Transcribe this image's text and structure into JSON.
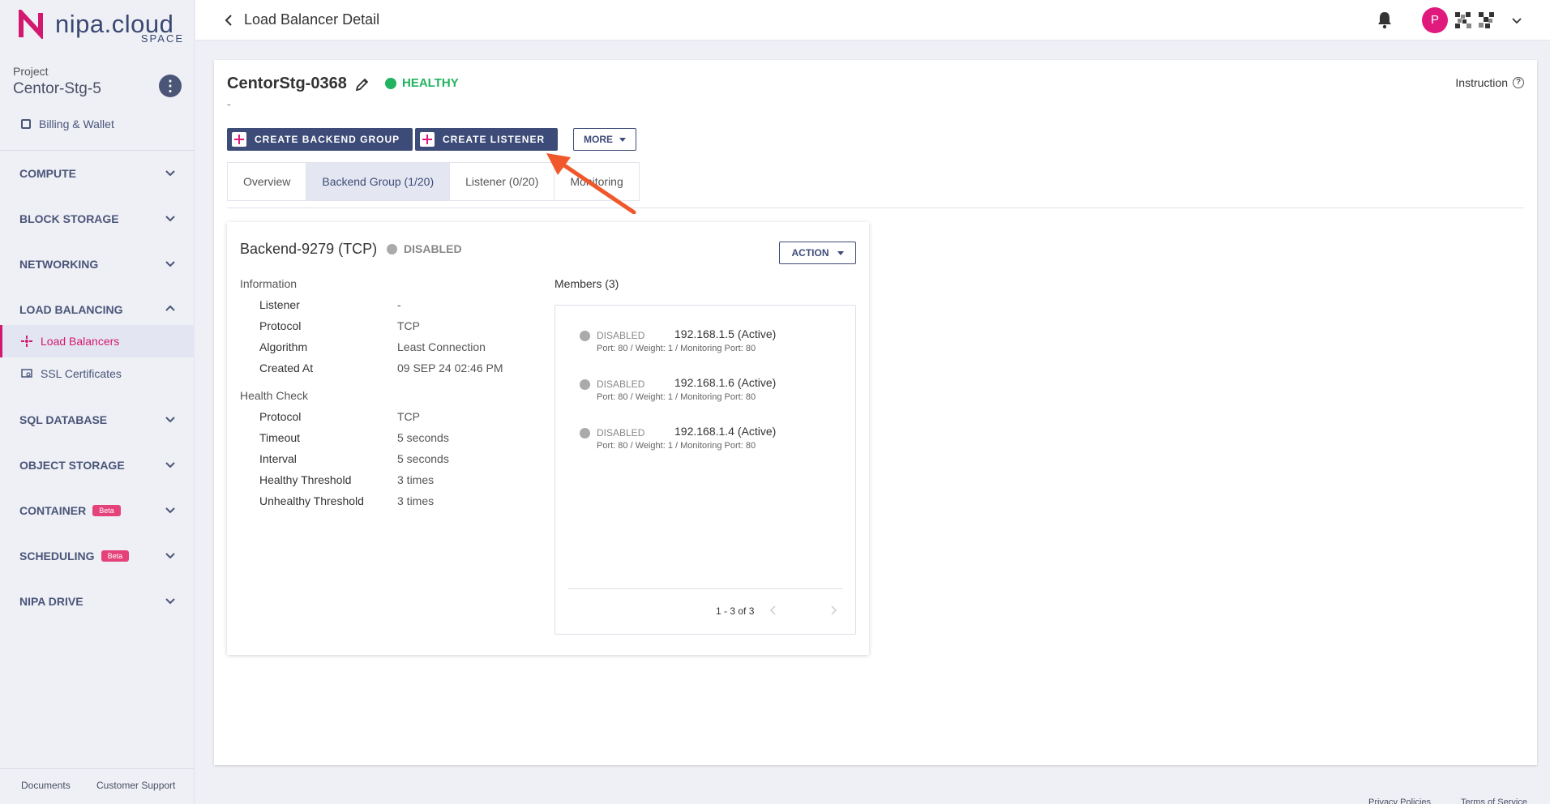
{
  "brand": {
    "name": "nipa.cloud",
    "sub": "SPACE"
  },
  "sidebar": {
    "project_label": "Project",
    "project_name": "Centor-Stg-5",
    "billing": "Billing & Wallet",
    "items": [
      {
        "label": "COMPUTE"
      },
      {
        "label": "BLOCK STORAGE"
      },
      {
        "label": "NETWORKING"
      },
      {
        "label": "LOAD BALANCING"
      },
      {
        "label": "SQL DATABASE"
      },
      {
        "label": "OBJECT STORAGE"
      },
      {
        "label": "CONTAINER",
        "badge": "Beta"
      },
      {
        "label": "SCHEDULING",
        "badge": "Beta"
      },
      {
        "label": "NIPA DRIVE"
      }
    ],
    "sub_items": [
      {
        "label": "Load Balancers"
      },
      {
        "label": "SSL Certificates"
      }
    ],
    "footer": {
      "documents": "Documents",
      "support": "Customer Support"
    }
  },
  "topbar": {
    "title": "Load Balancer Detail",
    "avatar_initial": "P"
  },
  "lb": {
    "name": "CentorStg-0368",
    "status": "HEALTHY",
    "description": "-",
    "instruction": "Instruction",
    "buttons": {
      "create_backend": "CREATE BACKEND GROUP",
      "create_listener": "CREATE LISTENER",
      "more": "MORE"
    },
    "tabs": [
      "Overview",
      "Backend Group (1/20)",
      "Listener (0/20)",
      "Monitoring"
    ]
  },
  "backend": {
    "title": "Backend-9279 (TCP)",
    "status": "DISABLED",
    "action": "ACTION",
    "info_label": "Information",
    "info": [
      {
        "key": "Listener",
        "value": "-"
      },
      {
        "key": "Protocol",
        "value": "TCP"
      },
      {
        "key": "Algorithm",
        "value": "Least Connection"
      },
      {
        "key": "Created At",
        "value": "09 SEP 24 02:46 PM"
      }
    ],
    "health_label": "Health Check",
    "health": [
      {
        "key": "Protocol",
        "value": "TCP"
      },
      {
        "key": "Timeout",
        "value": "5 seconds"
      },
      {
        "key": "Interval",
        "value": "5 seconds"
      },
      {
        "key": "Healthy Threshold",
        "value": "3 times"
      },
      {
        "key": "Unhealthy Threshold",
        "value": "3 times"
      }
    ],
    "members_label": "Members (3)",
    "members": [
      {
        "status": "DISABLED",
        "ip": "192.168.1.5 (Active)",
        "detail": "Port: 80 / Weight: 1 / Monitoring Port: 80"
      },
      {
        "status": "DISABLED",
        "ip": "192.168.1.6 (Active)",
        "detail": "Port: 80 / Weight: 1 / Monitoring Port: 80"
      },
      {
        "status": "DISABLED",
        "ip": "192.168.1.4 (Active)",
        "detail": "Port: 80 / Weight: 1 / Monitoring Port: 80"
      }
    ],
    "pagination": "1 - 3 of 3"
  },
  "bottom": {
    "privacy": "Privacy Policies",
    "terms": "Terms of Service"
  },
  "colors": {
    "accent": "#3d4b78",
    "brand_pink": "#e0197d",
    "healthy": "#22b35e",
    "annotation_arrow": "#f0582c"
  }
}
